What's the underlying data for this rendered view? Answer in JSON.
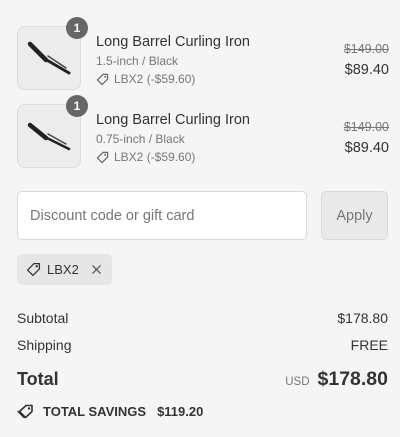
{
  "line_items": [
    {
      "quantity": "1",
      "title": "Long Barrel Curling Iron",
      "variant": "1.5-inch / Black",
      "discount": "LBX2 (-$59.60)",
      "original_price": "$149.00",
      "price": "$89.40"
    },
    {
      "quantity": "1",
      "title": "Long Barrel Curling Iron",
      "variant": "0.75-inch / Black",
      "discount": "LBX2 (-$59.60)",
      "original_price": "$149.00",
      "price": "$89.40"
    }
  ],
  "discount_form": {
    "placeholder": "Discount code or gift card",
    "value": "",
    "apply_label": "Apply"
  },
  "applied_code": {
    "code": "LBX2"
  },
  "summary": {
    "subtotal_label": "Subtotal",
    "subtotal_value": "$178.80",
    "shipping_label": "Shipping",
    "shipping_value": "FREE",
    "total_label": "Total",
    "currency": "USD",
    "total_value": "$178.80",
    "savings_label": "TOTAL SAVINGS",
    "savings_value": "$119.20"
  },
  "icons": {
    "product": "curling-iron-icon",
    "tag": "tag-icon",
    "remove": "close-icon",
    "savings": "savings-tag-icon"
  },
  "colors": {
    "background": "#f5f5f5",
    "text": "#333333",
    "muted": "#777777",
    "badge": "#666666"
  }
}
